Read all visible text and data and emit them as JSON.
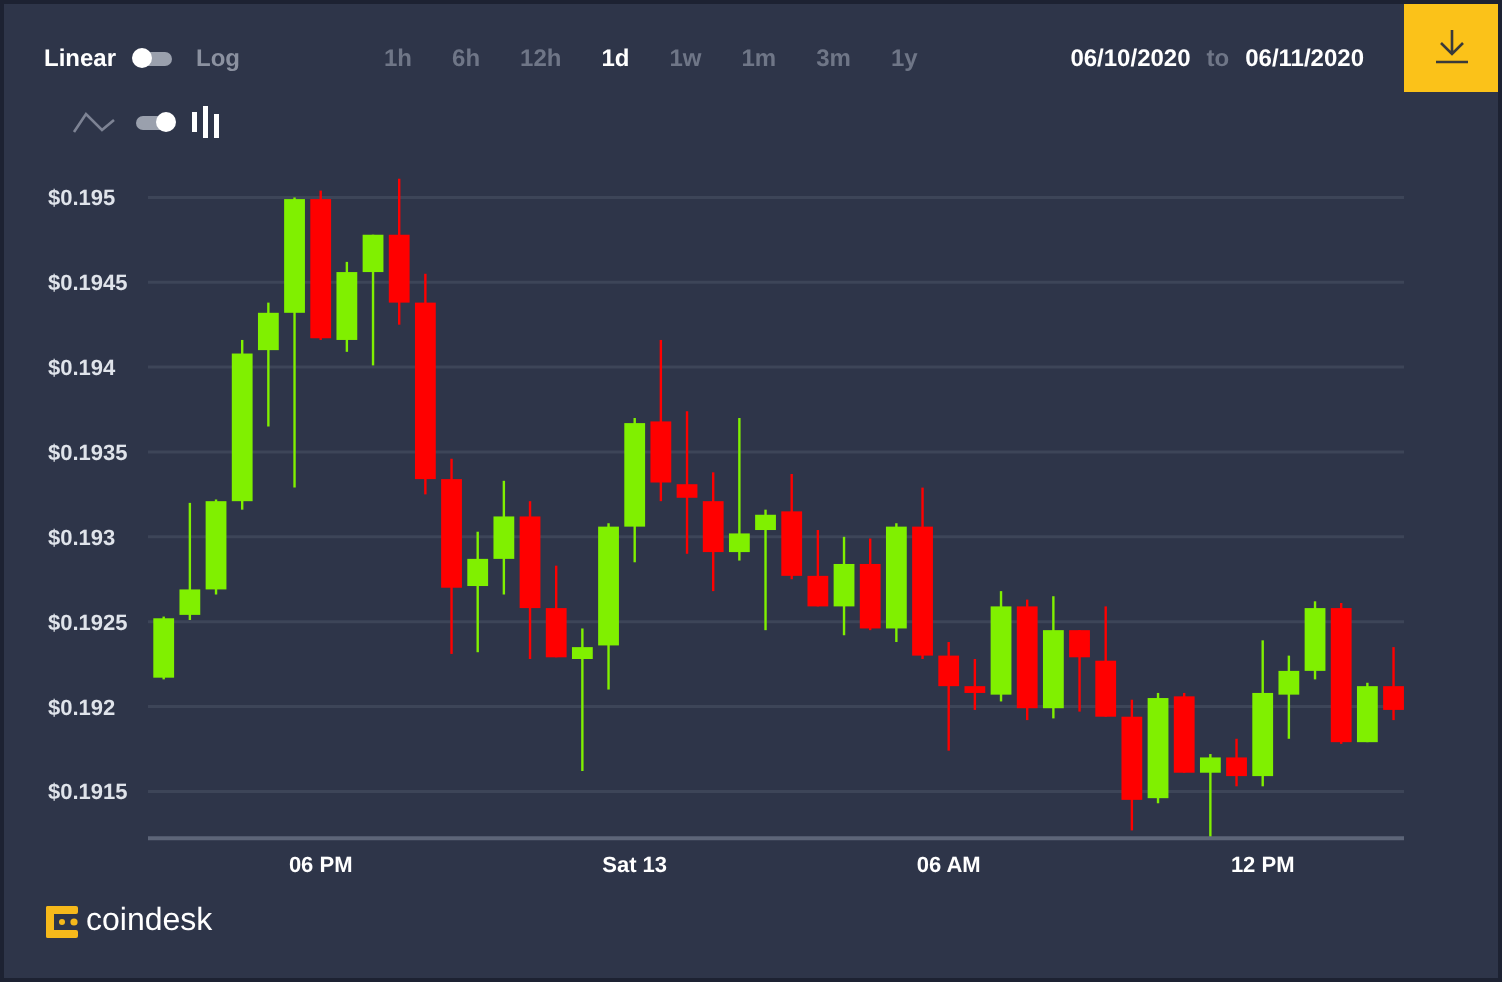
{
  "scale_toggle": {
    "left_label": "Linear",
    "right_label": "Log",
    "on": false
  },
  "intervals": [
    {
      "label": "1h",
      "selected": false
    },
    {
      "label": "6h",
      "selected": false
    },
    {
      "label": "12h",
      "selected": false
    },
    {
      "label": "1d",
      "selected": true
    },
    {
      "label": "1w",
      "selected": false
    },
    {
      "label": "1m",
      "selected": false
    },
    {
      "label": "3m",
      "selected": false
    },
    {
      "label": "1y",
      "selected": false
    }
  ],
  "date_range": {
    "from": "06/10/2020",
    "separator": "to",
    "to": "06/11/2020"
  },
  "chart_style_toggle": {
    "on": true
  },
  "chart": {
    "chart_data": {
      "type": "candlestick",
      "grid": true,
      "ylim": [
        0.19123,
        0.195
      ],
      "categories": [
        null,
        null,
        null,
        null,
        null,
        null,
        "06 PM",
        null,
        null,
        null,
        null,
        null,
        null,
        null,
        null,
        null,
        null,
        null,
        "Sat 13",
        null,
        null,
        null,
        null,
        null,
        null,
        null,
        null,
        null,
        null,
        null,
        "06 AM",
        null,
        null,
        null,
        null,
        null,
        null,
        null,
        null,
        null,
        null,
        null,
        "12 PM",
        null,
        null,
        null,
        null,
        null
      ],
      "ohlc": [
        [
          0.19217,
          0.19253,
          0.19216,
          0.19252
        ],
        [
          0.19254,
          0.1932,
          0.19251,
          0.19269
        ],
        [
          0.19269,
          0.19322,
          0.19266,
          0.19321
        ],
        [
          0.19321,
          0.19416,
          0.19316,
          0.19408
        ],
        [
          0.1941,
          0.19438,
          0.19365,
          0.19432
        ],
        [
          0.19432,
          0.195,
          0.19329,
          0.19499
        ],
        [
          0.19499,
          0.19504,
          0.19416,
          0.19417
        ],
        [
          0.19416,
          0.19462,
          0.19409,
          0.19456
        ],
        [
          0.19456,
          0.19478,
          0.19401,
          0.19478
        ],
        [
          0.19478,
          0.19511,
          0.19425,
          0.19438
        ],
        [
          0.19438,
          0.19455,
          0.19325,
          0.19334
        ],
        [
          0.19334,
          0.19346,
          0.19231,
          0.1927
        ],
        [
          0.19271,
          0.19303,
          0.19232,
          0.19287
        ],
        [
          0.19287,
          0.19333,
          0.19266,
          0.19312
        ],
        [
          0.19312,
          0.19321,
          0.19228,
          0.19258
        ],
        [
          0.19258,
          0.19283,
          0.19229,
          0.19229
        ],
        [
          0.19228,
          0.19246,
          0.19162,
          0.19235
        ],
        [
          0.19236,
          0.19308,
          0.1921,
          0.19306
        ],
        [
          0.19306,
          0.1937,
          0.19285,
          0.19367
        ],
        [
          0.19368,
          0.19416,
          0.19321,
          0.19332
        ],
        [
          0.19331,
          0.19374,
          0.1929,
          0.19323
        ],
        [
          0.19321,
          0.19338,
          0.19268,
          0.19291
        ],
        [
          0.19291,
          0.1937,
          0.19286,
          0.19302
        ],
        [
          0.19304,
          0.19316,
          0.19245,
          0.19313
        ],
        [
          0.19315,
          0.19337,
          0.19275,
          0.19277
        ],
        [
          0.19277,
          0.19304,
          0.19259,
          0.19259
        ],
        [
          0.19259,
          0.193,
          0.19242,
          0.19284
        ],
        [
          0.19284,
          0.19299,
          0.19245,
          0.19246
        ],
        [
          0.19246,
          0.19308,
          0.19238,
          0.19306
        ],
        [
          0.19306,
          0.19329,
          0.19228,
          0.1923
        ],
        [
          0.1923,
          0.19238,
          0.19174,
          0.19212
        ],
        [
          0.19212,
          0.19228,
          0.19198,
          0.19208
        ],
        [
          0.19207,
          0.19268,
          0.19203,
          0.19259
        ],
        [
          0.19259,
          0.19263,
          0.19192,
          0.19199
        ],
        [
          0.19199,
          0.19265,
          0.19193,
          0.19245
        ],
        [
          0.19245,
          0.19245,
          0.19197,
          0.19229
        ],
        [
          0.19227,
          0.19259,
          0.19194,
          0.19194
        ],
        [
          0.19194,
          0.19204,
          0.19127,
          0.19145
        ],
        [
          0.19146,
          0.19208,
          0.19143,
          0.19205
        ],
        [
          0.19206,
          0.19208,
          0.19161,
          0.19161
        ],
        [
          0.19161,
          0.19172,
          0.19123,
          0.1917
        ],
        [
          0.1917,
          0.19181,
          0.19153,
          0.19159
        ],
        [
          0.19159,
          0.19239,
          0.19153,
          0.19208
        ],
        [
          0.19207,
          0.1923,
          0.19181,
          0.19221
        ],
        [
          0.19221,
          0.19262,
          0.19216,
          0.19258
        ],
        [
          0.19258,
          0.19261,
          0.19178,
          0.19179
        ],
        [
          0.19179,
          0.19214,
          0.19179,
          0.19212
        ],
        [
          0.19212,
          0.19235,
          0.19192,
          0.19198
        ]
      ],
      "yticks": [
        {
          "value": 0.195,
          "label": "$0.195"
        },
        {
          "value": 0.1945,
          "label": "$0.1945"
        },
        {
          "value": 0.194,
          "label": "$0.194"
        },
        {
          "value": 0.1935,
          "label": "$0.1935"
        },
        {
          "value": 0.193,
          "label": "$0.193"
        },
        {
          "value": 0.1925,
          "label": "$0.1925"
        },
        {
          "value": 0.192,
          "label": "$0.192"
        },
        {
          "value": 0.1915,
          "label": "$0.1915"
        }
      ]
    }
  },
  "logo": {
    "text": "coindesk"
  }
}
